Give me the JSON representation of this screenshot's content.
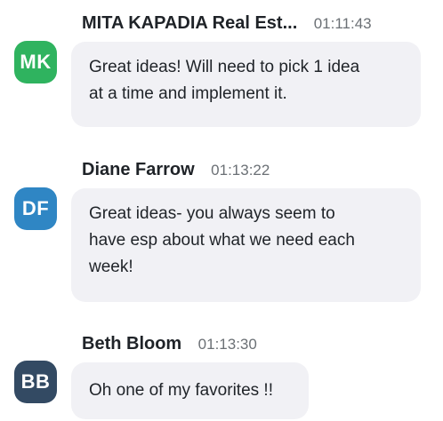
{
  "messages": [
    {
      "avatar_initials": "MK",
      "avatar_color": "#2fb35f",
      "sender": "MITA KAPADIA Real Est...",
      "time": "01:11:43",
      "text_lines": [
        "Great ideas! Will need to pick 1 idea",
        "at a time and implement it."
      ]
    },
    {
      "avatar_initials": "DF",
      "avatar_color": "#2f86c4",
      "sender": "Diane Farrow",
      "time": "01:13:22",
      "text_lines": [
        "Great ideas- you always seem to",
        "have esp about what we need each",
        "week!"
      ]
    },
    {
      "avatar_initials": "BB",
      "avatar_color": "#334a63",
      "sender": "Beth Bloom",
      "time": "01:13:30",
      "text_lines": [
        "Oh one of my favorites !!"
      ]
    }
  ]
}
